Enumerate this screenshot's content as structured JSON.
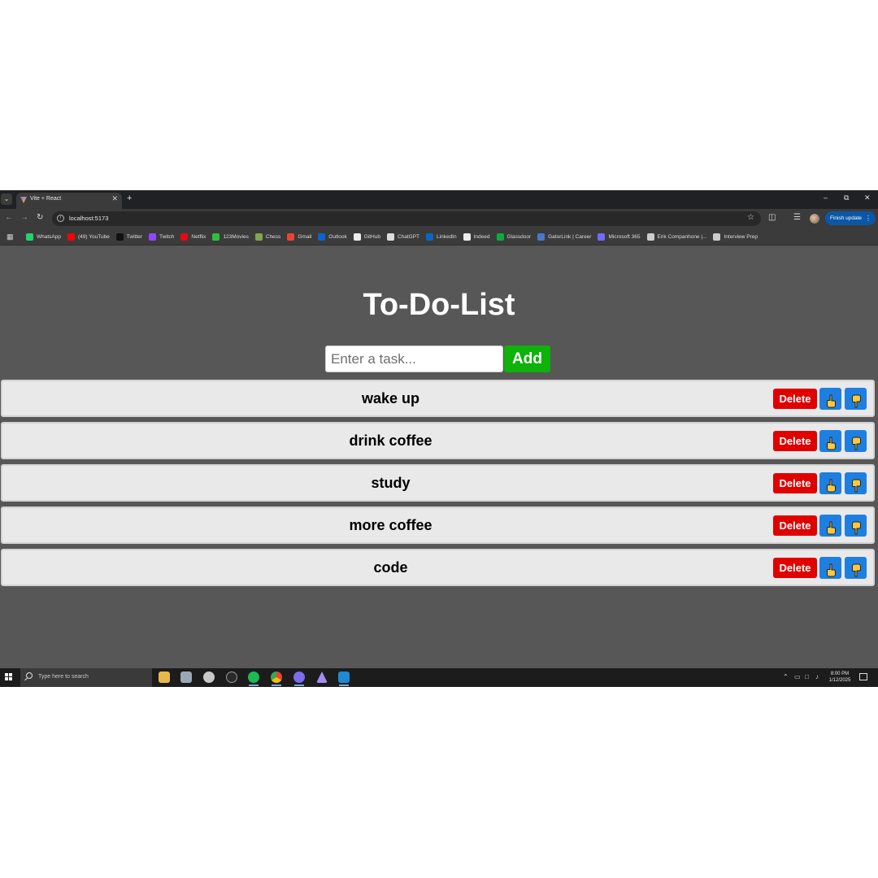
{
  "browser": {
    "tab_title": "Vite + React",
    "url": "localhost:5173",
    "update_button_label": "Finish update"
  },
  "bookmarks": [
    {
      "label": "WhatsApp",
      "icon": "whatsapp-icon",
      "color": "#25d366"
    },
    {
      "label": "(49) YouTube",
      "icon": "youtube-icon",
      "color": "#ff0000"
    },
    {
      "label": "Twitter",
      "icon": "x-icon",
      "color": "#111111"
    },
    {
      "label": "Twitch",
      "icon": "twitch-icon",
      "color": "#9146ff"
    },
    {
      "label": "Netflix",
      "icon": "netflix-icon",
      "color": "#e50914"
    },
    {
      "label": "123Movies",
      "icon": "play-icon",
      "color": "#2fbf3a"
    },
    {
      "label": "Chess",
      "icon": "chess-pawn-icon",
      "color": "#7fa650"
    },
    {
      "label": "Gmail",
      "icon": "gmail-icon",
      "color": "#ea4335"
    },
    {
      "label": "Outlook",
      "icon": "outlook-icon",
      "color": "#0a64d3"
    },
    {
      "label": "GitHub",
      "icon": "github-icon",
      "color": "#eeeeee"
    },
    {
      "label": "ChatGPT",
      "icon": "chatgpt-icon",
      "color": "#dddddd"
    },
    {
      "label": "LinkedIn",
      "icon": "linkedin-icon",
      "color": "#0a66c2"
    },
    {
      "label": "Indeed",
      "icon": "indeed-icon",
      "color": "#eeeeee"
    },
    {
      "label": "Glassdoor",
      "icon": "glassdoor-icon",
      "color": "#0caa41"
    },
    {
      "label": "GatorLink | Career",
      "icon": "gatorlink-icon",
      "color": "#4a77c9"
    },
    {
      "label": "Microsoft 365",
      "icon": "microsoft365-icon",
      "color": "#6d6dff"
    },
    {
      "label": "Erik Companhone |...",
      "icon": "globe-icon",
      "color": "#cccccc"
    },
    {
      "label": "Interview Prep",
      "icon": "folder-icon",
      "color": "#cccccc"
    }
  ],
  "app": {
    "title": "To-Do-List",
    "input_placeholder": "Enter a task...",
    "add_label": "Add",
    "delete_label": "Delete",
    "tasks": [
      "wake up",
      "drink coffee",
      "study",
      "more coffee",
      "code"
    ]
  },
  "taskbar": {
    "search_placeholder": "Type here to search",
    "time": "8:00 PM",
    "date": "1/12/2025"
  },
  "colors": {
    "page_background": "#575757",
    "add_button": "#0fb10b",
    "delete_button": "#e00000",
    "move_button": "#1e7fe0",
    "hand_icon": "#ffc83d"
  }
}
